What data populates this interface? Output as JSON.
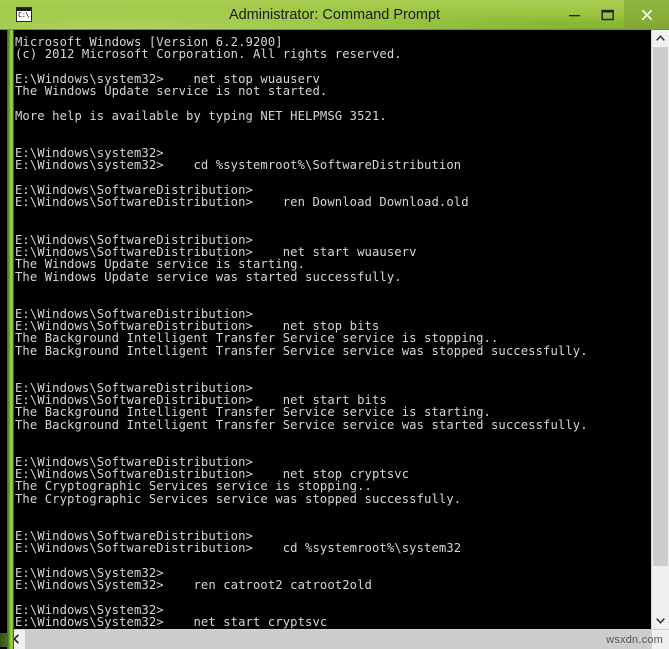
{
  "window": {
    "title": "Administrator: Command Prompt",
    "icon_label": "C:\\.",
    "caption": {
      "minimize": "–",
      "maximize": "▭",
      "close": "✕"
    }
  },
  "console": {
    "lines": [
      "Microsoft Windows [Version 6.2.9200]",
      "(c) 2012 Microsoft Corporation. All rights reserved.",
      "",
      "E:\\Windows\\system32>    net stop wuauserv",
      "The Windows Update service is not started.",
      "",
      "More help is available by typing NET HELPMSG 3521.",
      "",
      "",
      "E:\\Windows\\system32>",
      "E:\\Windows\\system32>    cd %systemroot%\\SoftwareDistribution",
      "",
      "E:\\Windows\\SoftwareDistribution>",
      "E:\\Windows\\SoftwareDistribution>    ren Download Download.old",
      "",
      "",
      "E:\\Windows\\SoftwareDistribution>",
      "E:\\Windows\\SoftwareDistribution>    net start wuauserv",
      "The Windows Update service is starting.",
      "The Windows Update service was started successfully.",
      "",
      "",
      "E:\\Windows\\SoftwareDistribution>",
      "E:\\Windows\\SoftwareDistribution>    net stop bits",
      "The Background Intelligent Transfer Service service is stopping..",
      "The Background Intelligent Transfer Service service was stopped successfully.",
      "",
      "",
      "E:\\Windows\\SoftwareDistribution>",
      "E:\\Windows\\SoftwareDistribution>    net start bits",
      "The Background Intelligent Transfer Service service is starting.",
      "The Background Intelligent Transfer Service service was started successfully.",
      "",
      "",
      "E:\\Windows\\SoftwareDistribution>",
      "E:\\Windows\\SoftwareDistribution>    net stop cryptsvc",
      "The Cryptographic Services service is stopping..",
      "The Cryptographic Services service was stopped successfully.",
      "",
      "",
      "E:\\Windows\\SoftwareDistribution>",
      "E:\\Windows\\SoftwareDistribution>    cd %systemroot%\\system32",
      "",
      "E:\\Windows\\System32>",
      "E:\\Windows\\System32>    ren catroot2 catroot2old",
      "",
      "E:\\Windows\\System32>",
      "E:\\Windows\\System32>    net start cryptsvc"
    ]
  },
  "scrollbars": {
    "vertical_up": "scroll-up-arrow",
    "vertical_down": "scroll-down-arrow",
    "horizontal_left": "scroll-left-arrow"
  },
  "watermark": {
    "text": "wsxdn.com"
  },
  "colors": {
    "titlebar": "#9ec744",
    "console_bg": "#000000",
    "console_fg": "#d6d6d6",
    "scrollbar_track": "#f0f0f0",
    "scrollbar_thumb": "#cdcdcd"
  }
}
